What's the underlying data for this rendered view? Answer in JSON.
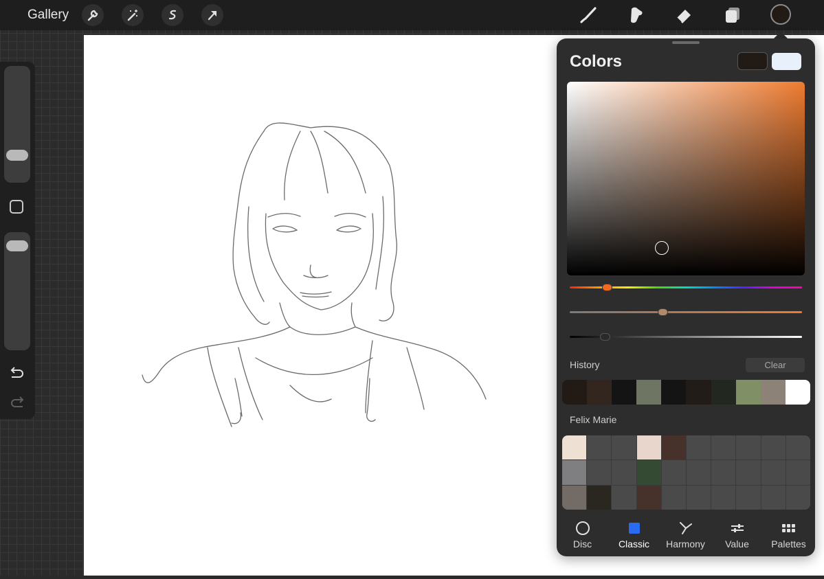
{
  "topbar": {
    "gallery_label": "Gallery",
    "left_tools": [
      "wrench-icon",
      "magic-wand-icon",
      "selection-icon",
      "transform-arrow-icon"
    ],
    "right_tools": [
      "brush-icon",
      "smudge-icon",
      "eraser-icon",
      "layers-icon"
    ],
    "current_color": "#221a15"
  },
  "sidebar": {
    "brush_size_level": 0.14,
    "opacity_level": 0.92,
    "icons": [
      "modify-square-icon",
      "undo-icon",
      "redo-icon"
    ]
  },
  "colors_panel": {
    "title": "Colors",
    "primary_swatch": "#221a15",
    "secondary_swatch": "#e8f0fb",
    "hue_color": "#ee7b30",
    "hue_level": 0.16,
    "saturation_level": 0.4,
    "brightness_level": 0.15,
    "history_label": "History",
    "clear_label": "Clear",
    "history_colors": [
      "#221a15",
      "#33261f",
      "#141414",
      "#6e7663",
      "#141414",
      "#221c18",
      "#222820",
      "#818f66",
      "#8c8278",
      "#ffffff"
    ],
    "palette_name": "Felix Marie",
    "palette_colors": [
      "#eee0d2",
      "#4a4a4a",
      "#4a4a4a",
      "#e8d5cc",
      "#46322a",
      "#4a4a4a",
      "#4a4a4a",
      "#4a4a4a",
      "#4a4a4a",
      "#4a4a4a",
      "#7f7e80",
      "#4a4a4a",
      "#4a4a4a",
      "#344a33",
      "#4a4a4a",
      "#4a4a4a",
      "#4a4a4a",
      "#4a4a4a",
      "#4a4a4a",
      "#4a4a4a",
      "#736b66",
      "#2a2620",
      "#4a4a4a",
      "#46322a",
      "#4a4a4a",
      "#4a4a4a",
      "#4a4a4a",
      "#4a4a4a",
      "#4a4a4a",
      "#4a4a4a"
    ],
    "tabs": [
      {
        "label": "Disc",
        "icon": "disc-icon"
      },
      {
        "label": "Classic",
        "icon": "classic-square-icon"
      },
      {
        "label": "Harmony",
        "icon": "harmony-icon"
      },
      {
        "label": "Value",
        "icon": "value-sliders-icon"
      },
      {
        "label": "Palettes",
        "icon": "palettes-grid-icon"
      }
    ],
    "active_tab": "Classic",
    "accent": "#2a6bf2"
  }
}
